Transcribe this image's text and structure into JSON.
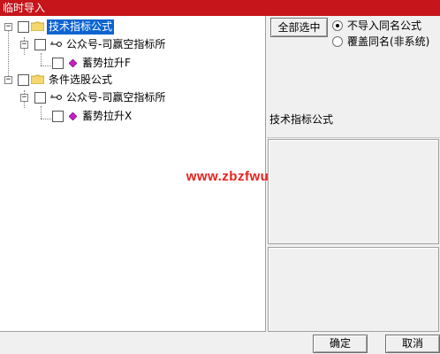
{
  "window": {
    "title": "临时导入"
  },
  "tree": {
    "root1": {
      "label": "技术指标公式"
    },
    "root1_child": {
      "label": "公众号-司赢空指标所"
    },
    "root1_leaf": {
      "label": "蓄势拉升F"
    },
    "root2": {
      "label": "条件选股公式"
    },
    "root2_child": {
      "label": "公众号-司赢空指标所"
    },
    "root2_leaf": {
      "label": "蓄势拉升X"
    }
  },
  "watermark": {
    "text": "www.zbzfwu.com"
  },
  "options": {
    "select_all_label": "全部选中",
    "radio_no_import_label": "不导入同名公式",
    "radio_overwrite_label": "覆盖同名(非系统)"
  },
  "detail": {
    "category_label": "技术指标公式"
  },
  "footer": {
    "ok_label": "确定",
    "cancel_label": "取消"
  },
  "colors": {
    "titlebar": "#c6151b",
    "selection": "#0a64d2",
    "watermark": "#e8211b"
  }
}
